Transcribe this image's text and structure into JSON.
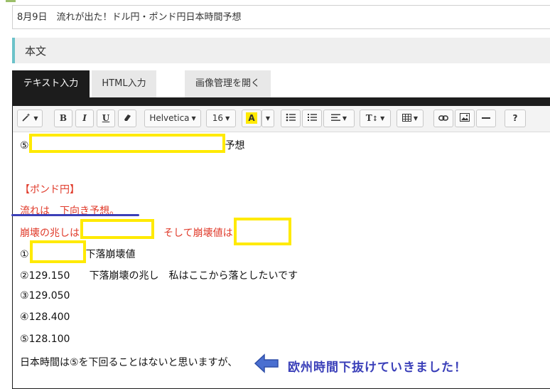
{
  "post_title": "8月9日　流れが出た！ドル円・ポンド円日本時間予想",
  "section": {
    "label": "本文"
  },
  "tabs": [
    {
      "label": "テキスト入力",
      "active": true
    },
    {
      "label": "HTML入力",
      "active": false
    },
    {
      "label": "画像管理を開く",
      "active": false
    }
  ],
  "toolbar": {
    "magic_label": "",
    "bold_label": "B",
    "italic_label": "I",
    "underline_label": "U",
    "eraser_label": "",
    "font_family": "Helvetica",
    "font_size": "16",
    "color_label": "A",
    "style_label": "T",
    "help_label": "?"
  },
  "content": {
    "line1_prefix": "⑤",
    "line1_suffix": "予想",
    "gbp_heading": "【ポンド円】",
    "trend_line": "流れは　下向き予想。",
    "collapse_sign_prefix": "崩壊の兆しは",
    "collapse_value_prefix": "そして崩壊値は",
    "levels": [
      {
        "marker": "①",
        "value": "",
        "note": "下落崩壊値"
      },
      {
        "marker": "②",
        "value": "129.150",
        "note": "下落崩壊の兆し　私はここから落としたいです"
      },
      {
        "marker": "③",
        "value": "129.050",
        "note": ""
      },
      {
        "marker": "④",
        "value": "128.400",
        "note": ""
      },
      {
        "marker": "⑤",
        "value": "128.100",
        "note": ""
      }
    ],
    "last_line": "日本時間は⑤を下回ることはないと思いますが、"
  },
  "annotation": {
    "text": "欧州時間下抜けていきました！",
    "color": "#3a3fb9"
  },
  "colors": {
    "highlight_box": "#ffea00",
    "red_text": "#e03a2a",
    "accent_bar": "#6cc2c9",
    "tab_active_bg": "#1c1c1c"
  }
}
